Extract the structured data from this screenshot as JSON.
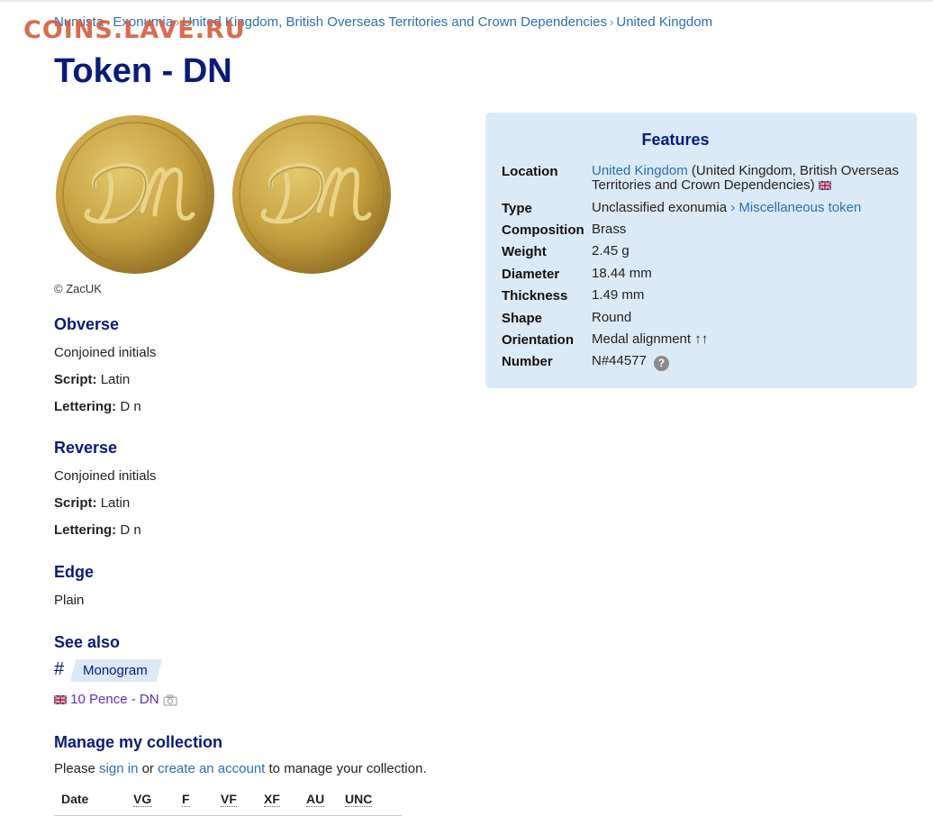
{
  "breadcrumb": {
    "items": [
      "Numista",
      "Exonumia",
      "United Kingdom, British Overseas Territories and Crown Dependencies",
      "United Kingdom"
    ],
    "separator": "›"
  },
  "watermark": "COINS.LAVE.RU",
  "title": "Token - DN",
  "images": {
    "copyright": "© ZacUK",
    "coin_color": "#c9a646"
  },
  "obverse": {
    "heading": "Obverse",
    "description": "Conjoined initials",
    "script_label": "Script:",
    "script": "Latin",
    "lettering_label": "Lettering:",
    "lettering": "D n"
  },
  "reverse": {
    "heading": "Reverse",
    "description": "Conjoined initials",
    "script_label": "Script:",
    "script": "Latin",
    "lettering_label": "Lettering:",
    "lettering": "D n"
  },
  "edge": {
    "heading": "Edge",
    "value": "Plain"
  },
  "see_also": {
    "heading": "See also",
    "hash": "#",
    "tag": "Monogram",
    "link": "10 Pence - DN",
    "flag_icon": "uk-flag-icon",
    "camera_icon": "camera-icon"
  },
  "collection": {
    "heading": "Manage my collection",
    "text_before": "Please",
    "sign_in": "sign in",
    "or": "or",
    "create_account": "create an account",
    "text_after": "to manage your collection.",
    "grades": [
      "Date",
      "VG",
      "F",
      "VF",
      "XF",
      "AU",
      "UNC"
    ]
  },
  "features": {
    "heading": "Features",
    "location_label": "Location",
    "location_link": "United Kingdom",
    "location_rest": "(United Kingdom, British Overseas Territories and Crown Dependencies)",
    "type_label": "Type",
    "type_value": "Unclassified exonumia",
    "type_sep": "›",
    "type_link": "Miscellaneous token",
    "composition_label": "Composition",
    "composition": "Brass",
    "weight_label": "Weight",
    "weight": "2.45 g",
    "diameter_label": "Diameter",
    "diameter": "18.44 mm",
    "thickness_label": "Thickness",
    "thickness": "1.49 mm",
    "shape_label": "Shape",
    "shape": "Round",
    "orientation_label": "Orientation",
    "orientation": "Medal alignment ↑↑",
    "number_label": "Number",
    "number": "N#44577",
    "help": "?"
  },
  "colors": {
    "heading": "#0a1a7a",
    "link": "#2a6fb0",
    "visited_link": "#5b2fb5",
    "panel": "#dbeaf7"
  }
}
